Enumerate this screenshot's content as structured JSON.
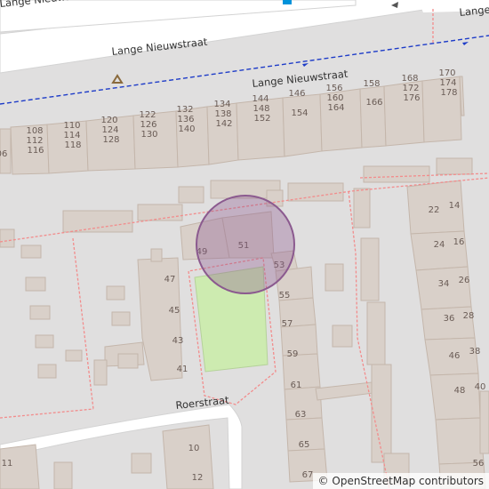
{
  "map": {
    "colors": {
      "background": "#e0dfdf",
      "building": "#d9d0c9",
      "building_stroke": "#c4b6ab",
      "road": "#ffffff",
      "parcel_boundary": "#f28c8c",
      "bus_route": "#1e3cc8",
      "park": "#cdebb0",
      "location_circle": "#8b5a8f",
      "text": "#6a5c56"
    },
    "roads": {
      "lange_nieuwstraat": "Lange Nieuwstraat",
      "lange_nieuwstraat_right": "Lange",
      "roerstraat": "Roerstraat"
    },
    "icons": {
      "recycling": "recycling-icon",
      "parking": "parking-icon"
    },
    "house_numbers": {
      "north": [
        "06",
        "108",
        "112",
        "116",
        "110",
        "114",
        "118",
        "120",
        "124",
        "128",
        "122",
        "126",
        "130",
        "132",
        "136",
        "140",
        "134",
        "138",
        "142",
        "144",
        "148",
        "152",
        "146",
        "154",
        "156",
        "160",
        "164",
        "158",
        "166",
        "168",
        "172",
        "176",
        "170",
        "174",
        "178"
      ],
      "middle": [
        "47",
        "45",
        "43",
        "41",
        "49",
        "51",
        "53",
        "55",
        "57",
        "59",
        "61",
        "63",
        "65",
        "67"
      ],
      "east": [
        "22",
        "14",
        "24",
        "16",
        "34",
        "26",
        "36",
        "28",
        "46",
        "38",
        "48",
        "40",
        "56"
      ],
      "south": [
        "10",
        "12",
        "11"
      ]
    },
    "marker": {
      "type": "location-circle"
    }
  },
  "attribution": {
    "symbol": "©",
    "text": "OpenStreetMap contributors"
  }
}
